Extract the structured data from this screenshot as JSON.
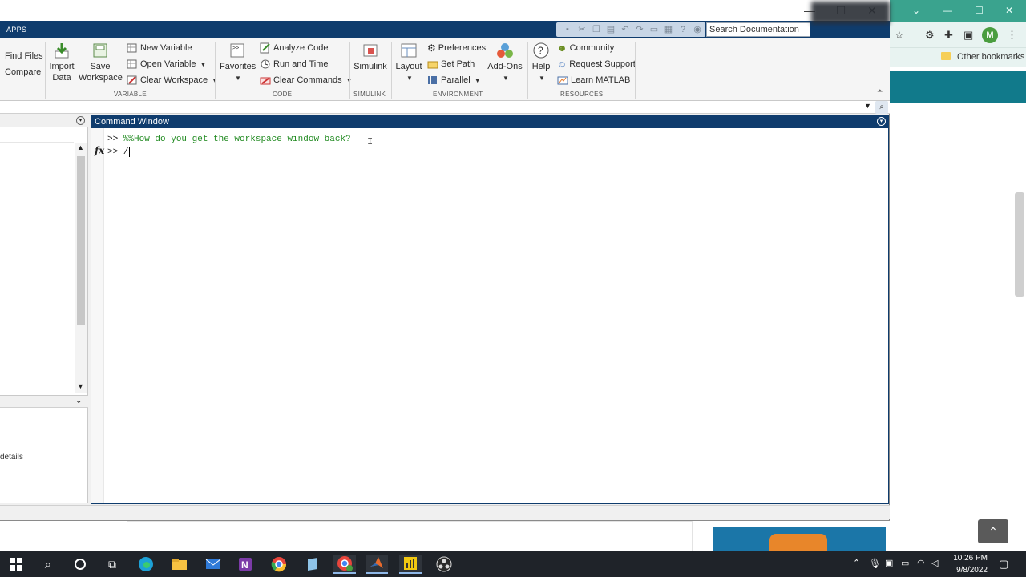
{
  "browser": {
    "other_bookmarks": "Other bookmarks",
    "avatar_letter": "M"
  },
  "matlab": {
    "tab_apps": "APPS",
    "search_placeholder": "Search Documentation",
    "ribbon": {
      "find_files": "Find Files",
      "compare": "Compare",
      "import_data_1": "Import",
      "import_data_2": "Data",
      "save_workspace_1": "Save",
      "save_workspace_2": "Workspace",
      "new_variable": "New Variable",
      "open_variable": "Open Variable",
      "clear_workspace": "Clear Workspace",
      "favorites": "Favorites",
      "analyze_code": "Analyze Code",
      "run_and_time": "Run and Time",
      "clear_commands": "Clear Commands",
      "simulink": "Simulink",
      "layout": "Layout",
      "preferences": "Preferences",
      "set_path": "Set Path",
      "parallel": "Parallel",
      "add_ons": "Add-Ons",
      "help": "Help",
      "community": "Community",
      "request_support": "Request Support",
      "learn_matlab": "Learn MATLAB",
      "sections": {
        "variable": "VARIABLE",
        "code": "CODE",
        "simulink": "SIMULINK",
        "environment": "ENVIRONMENT",
        "resources": "RESOURCES"
      }
    },
    "left_panel": {
      "details_text": "details"
    },
    "command_window": {
      "title": "Command Window",
      "line1_prompt": ">> ",
      "line1_comment": "%%How do you get the workspace window back?",
      "line2_prompt": ">> ",
      "line2_input": "/",
      "fx_label": "fx"
    }
  },
  "taskbar": {
    "time": "10:26 PM",
    "date": "9/8/2022"
  }
}
